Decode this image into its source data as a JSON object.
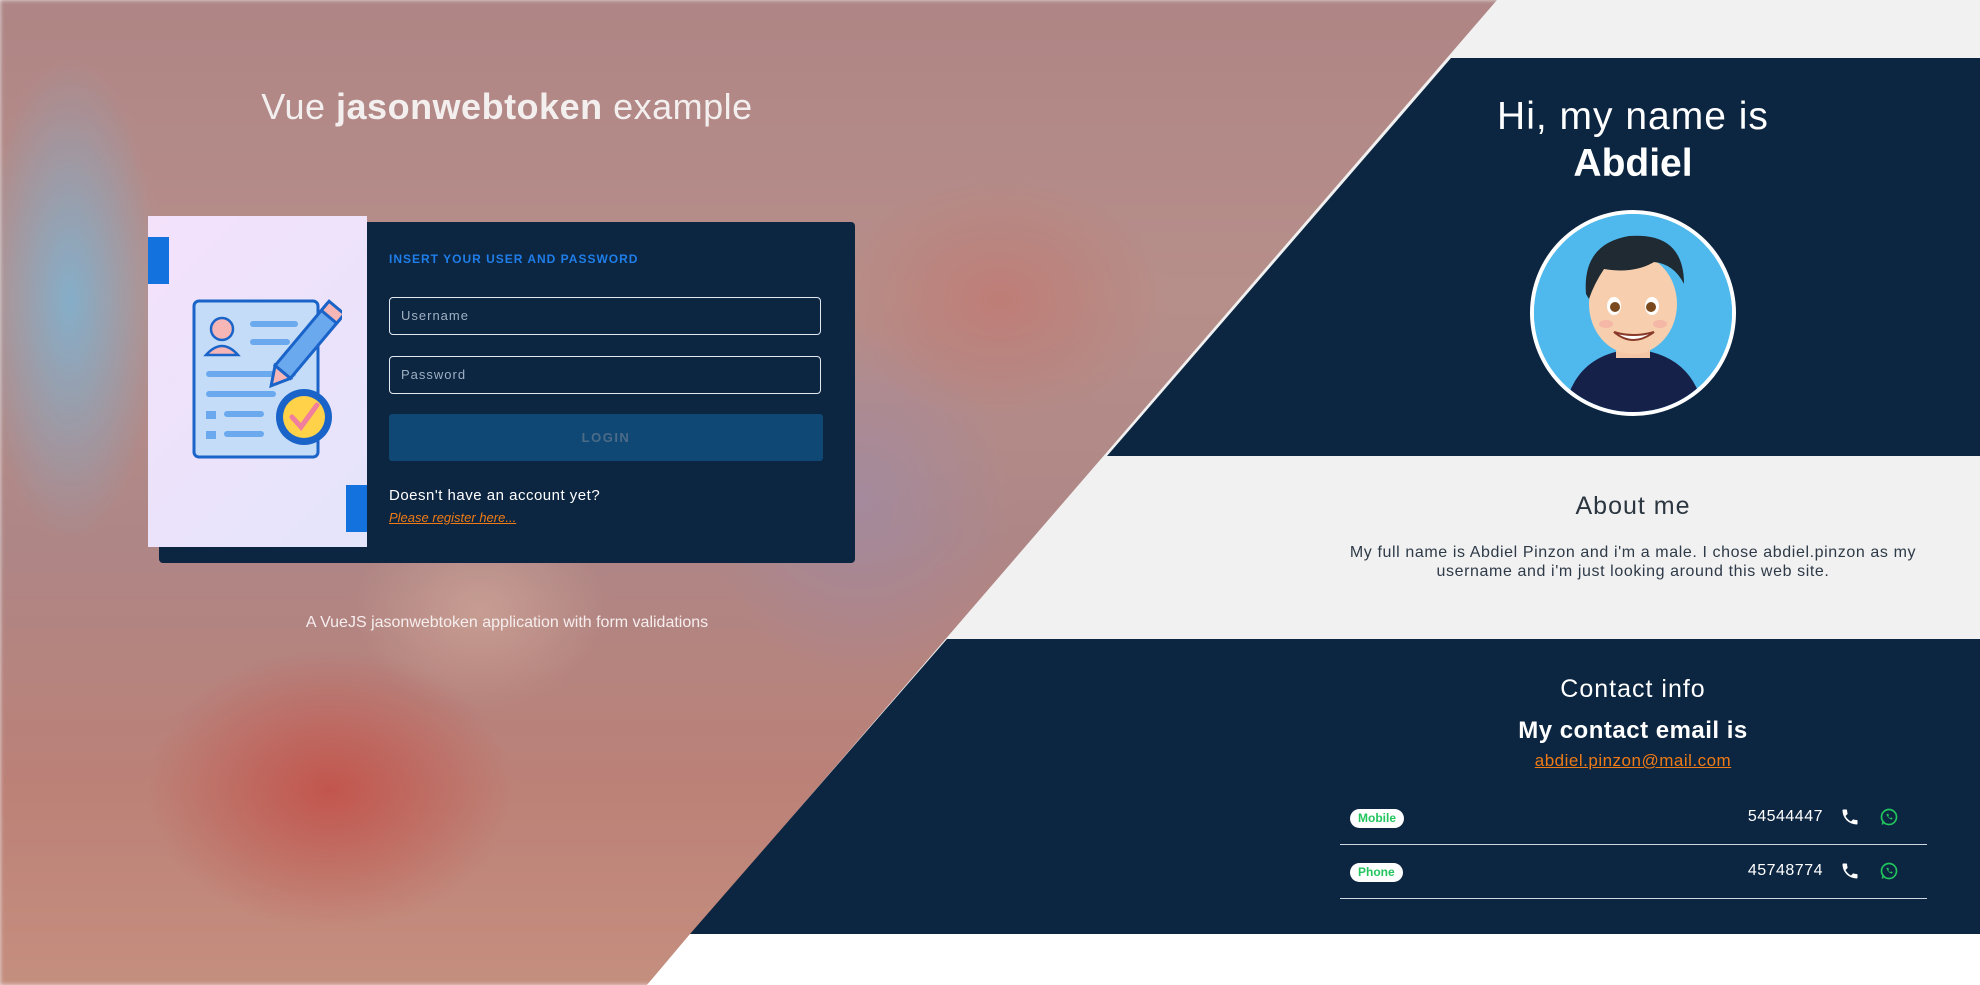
{
  "login": {
    "title_prefix": "Vue",
    "title_bold": "jasonwebtoken",
    "title_suffix": "example",
    "form_heading": "INSERT YOUR USER AND PASSWORD",
    "username_placeholder": "Username",
    "password_placeholder": "Password",
    "login_label": "LOGIN",
    "no_account_text": "Doesn't have an account yet?",
    "register_link": "Please register here...",
    "caption": "A VueJS jasonwebtoken application with form validations"
  },
  "profile": {
    "greeting": "Hi, my name is",
    "name": "Abdiel",
    "about_title": "About me",
    "about_text": "My full name is Abdiel Pinzon and i'm a male. I chose abdiel.pinzon as my username and i'm just looking around this web site.",
    "contact_title": "Contact info",
    "email_title": "My contact email is",
    "email": "abdiel.pinzon@mail.com",
    "contacts": [
      {
        "type": "Mobile",
        "number": "54544447"
      },
      {
        "type": "Phone",
        "number": "45748774"
      }
    ]
  },
  "colors": {
    "navy": "#0c2540",
    "accent_orange": "#ee7b16",
    "accent_blue": "#1f7ee9",
    "badge_green": "#22c55e"
  },
  "icons": [
    "login-illustration",
    "avatar-image",
    "phone-icon",
    "whatsapp-icon"
  ]
}
